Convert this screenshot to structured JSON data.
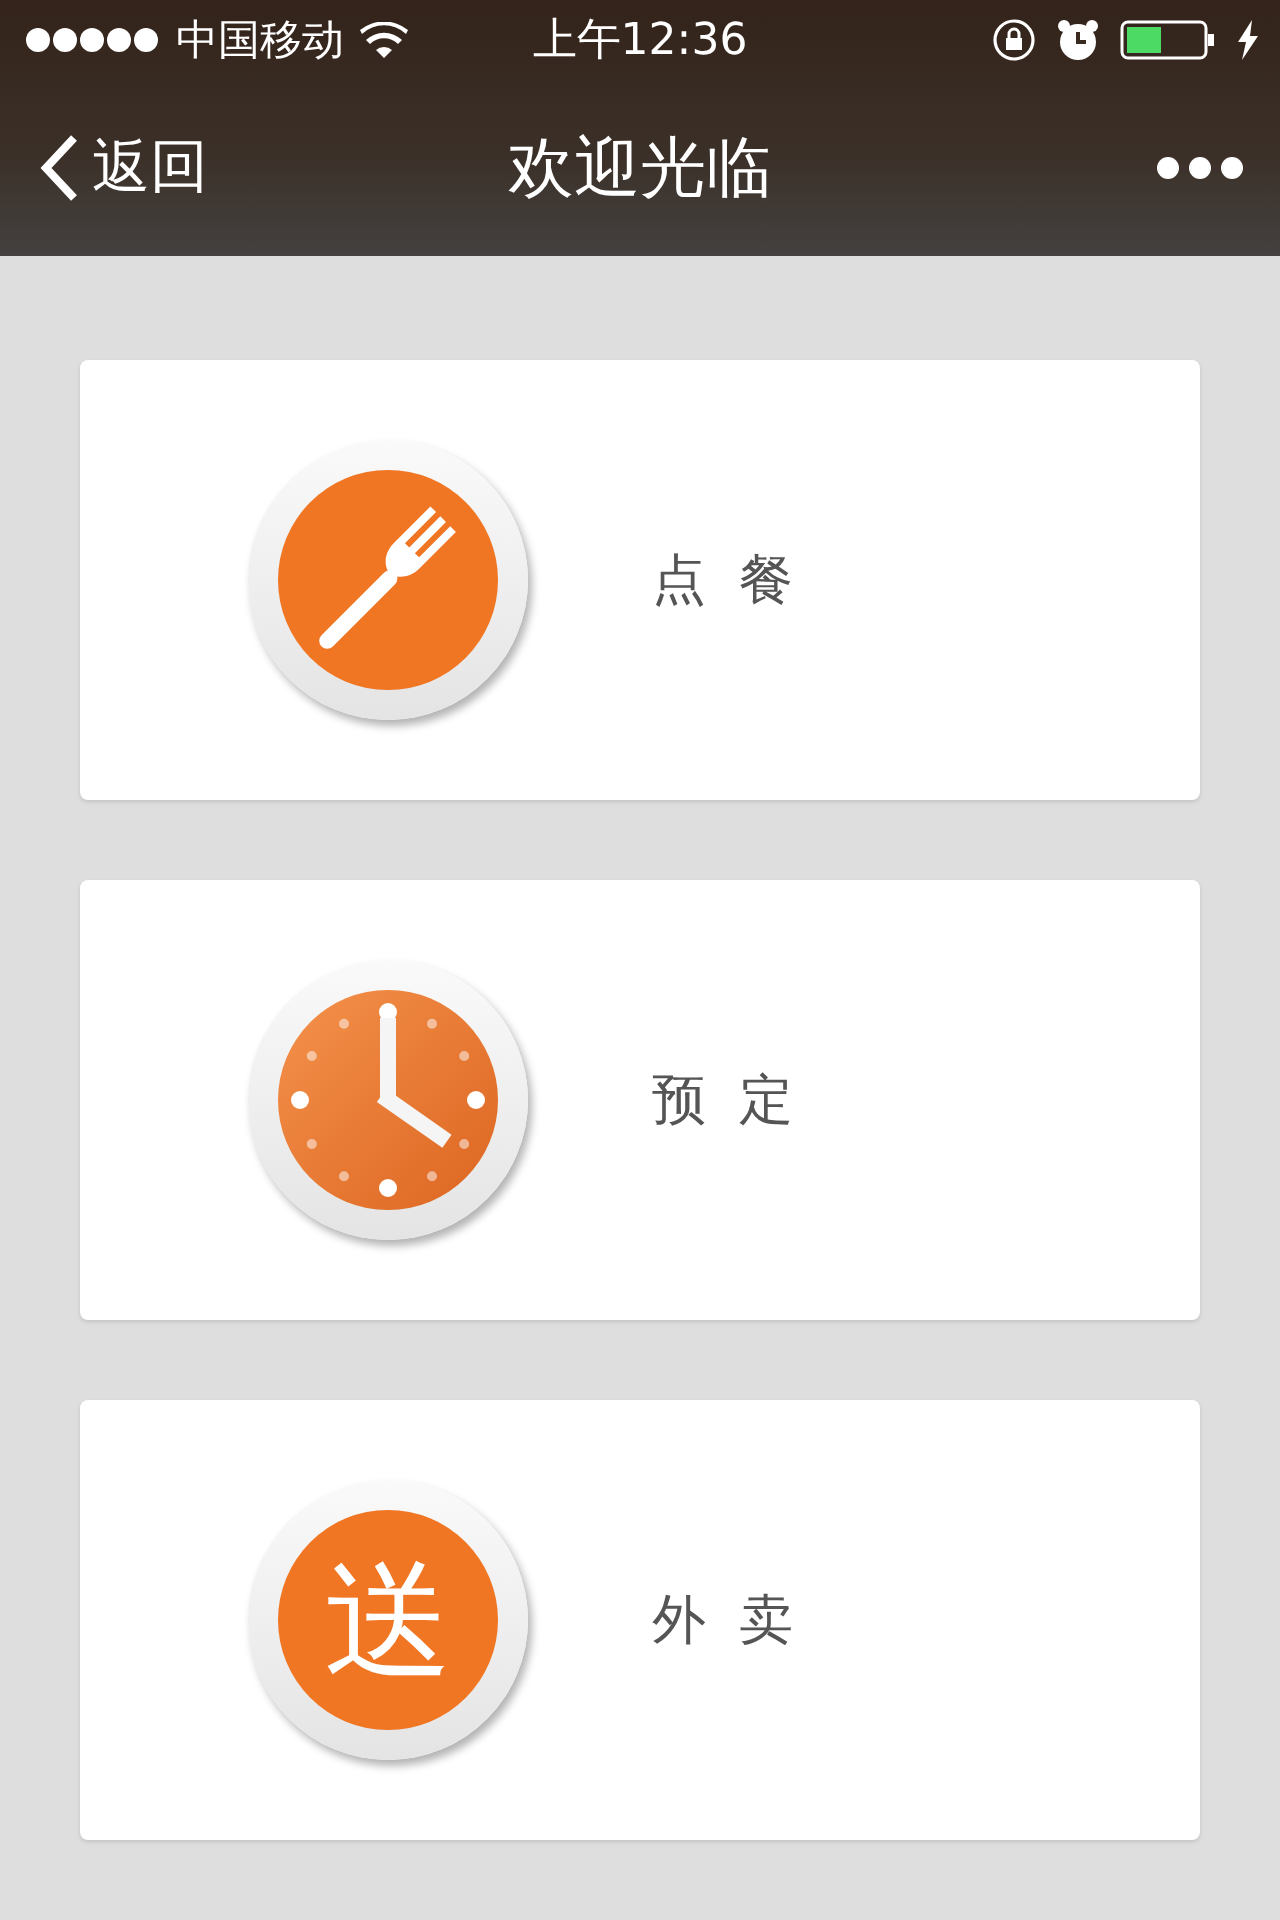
{
  "status_bar": {
    "carrier": "中国移动",
    "time": "上午12:36"
  },
  "nav_bar": {
    "back": "返回",
    "title": "欢迎光临"
  },
  "menu": [
    {
      "kind": "fork",
      "label": "点 餐"
    },
    {
      "kind": "clock",
      "label": "预 定"
    },
    {
      "kind": "glyph",
      "glyph": "送",
      "label": "外 卖"
    }
  ]
}
